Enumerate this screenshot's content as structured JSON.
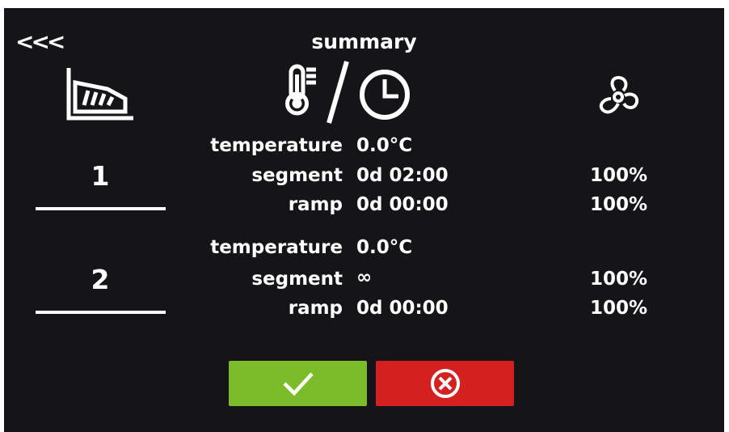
{
  "header": {
    "back_label": "<<<",
    "title": "summary"
  },
  "icons": {
    "profile": "profile-chart-icon",
    "temperature_time": "thermometer-clock-icon",
    "fan": "fan-icon",
    "confirm": "check-icon",
    "cancel": "close-circle-icon"
  },
  "segments": [
    {
      "number": "1",
      "temperature_label": "temperature",
      "temperature_value": "0.0°C",
      "segment_label": "segment",
      "segment_value": "0d 02:00",
      "segment_fan": "100%",
      "ramp_label": "ramp",
      "ramp_value": "0d 00:00",
      "ramp_fan": "100%"
    },
    {
      "number": "2",
      "temperature_label": "temperature",
      "temperature_value": "0.0°C",
      "segment_label": "segment",
      "segment_value": "∞",
      "segment_fan": "100%",
      "ramp_label": "ramp",
      "ramp_value": "0d 00:00",
      "ramp_fan": "100%"
    }
  ],
  "colors": {
    "background": "#151519",
    "confirm": "#7cbc2a",
    "cancel": "#d4201f"
  }
}
